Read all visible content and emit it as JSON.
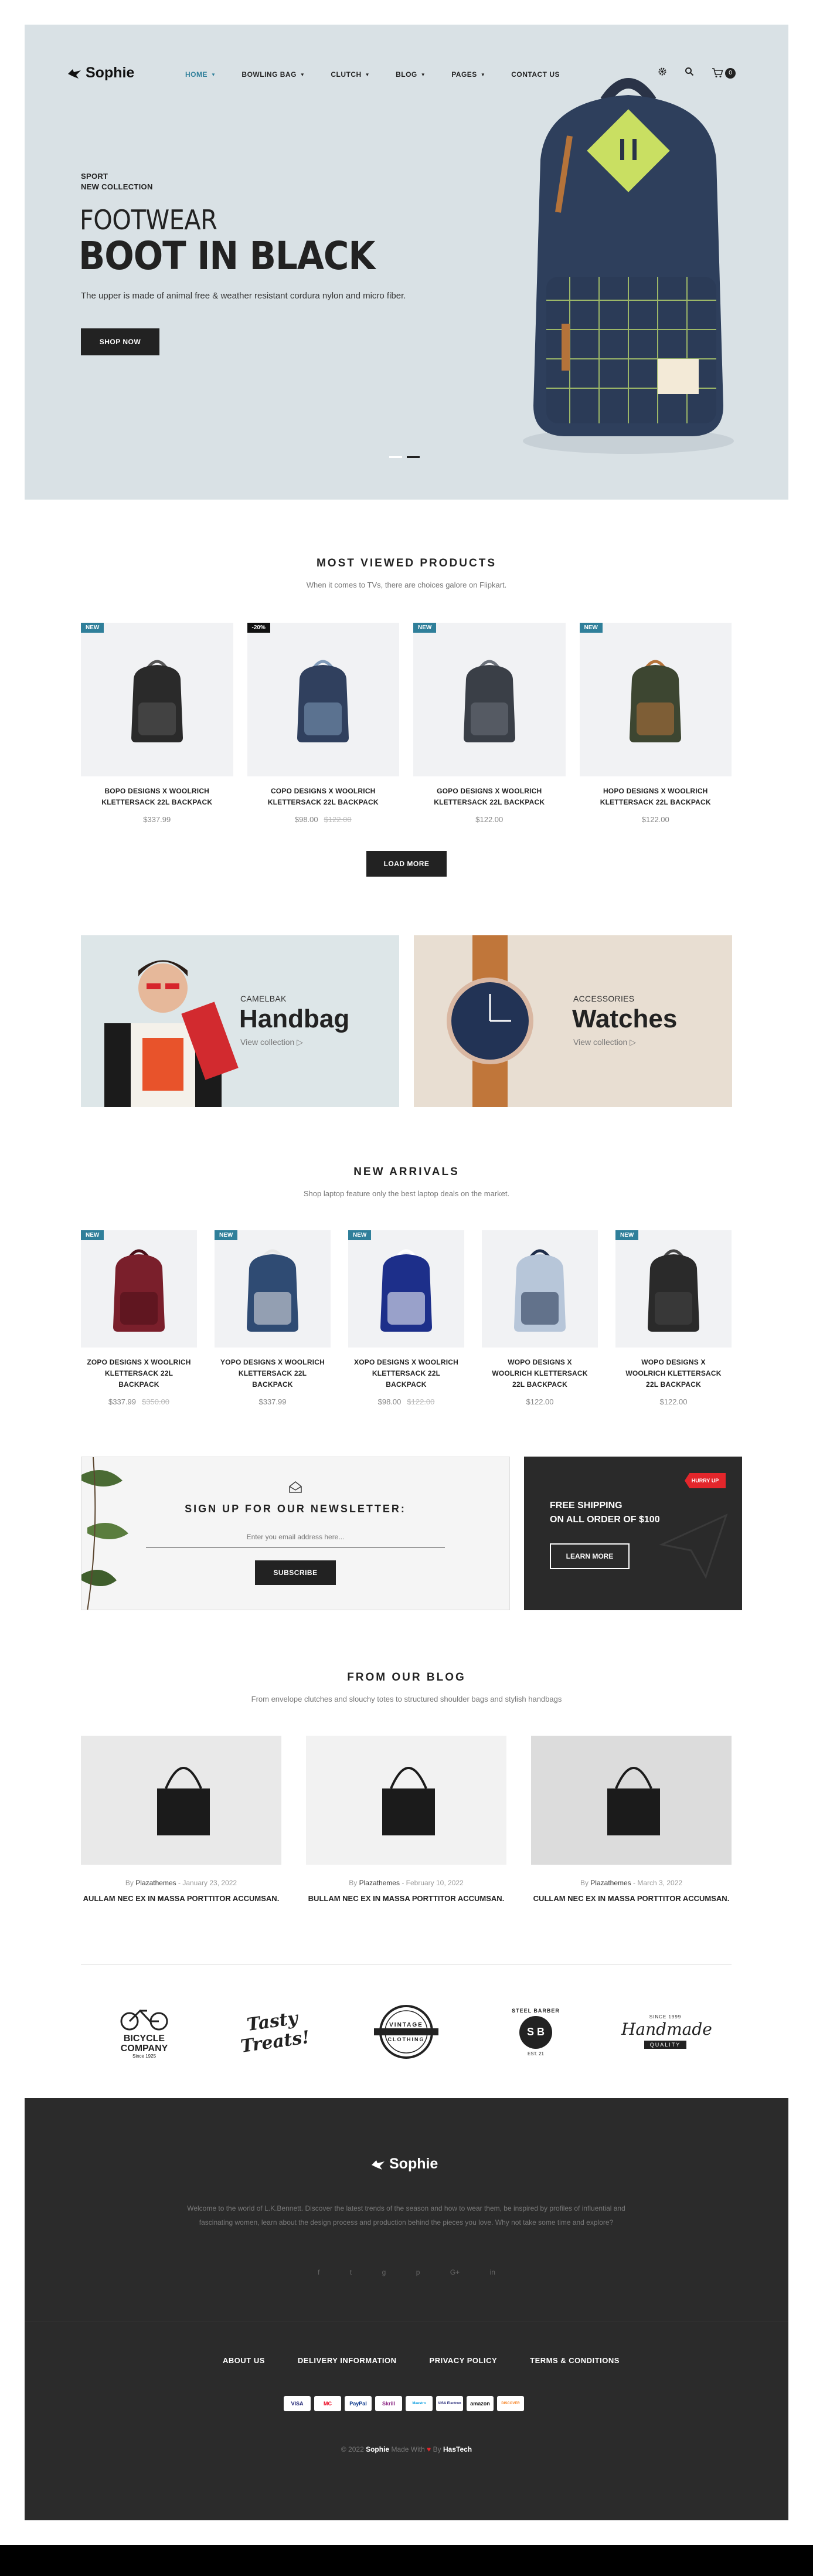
{
  "header": {
    "logo": "Sophie",
    "nav": [
      {
        "label": "HOME",
        "active": true,
        "dropdown": true
      },
      {
        "label": "BOWLING BAG",
        "dropdown": true
      },
      {
        "label": "CLUTCH",
        "dropdown": true
      },
      {
        "label": "BLOG",
        "dropdown": true
      },
      {
        "label": "PAGES",
        "dropdown": true
      },
      {
        "label": "CONTACT US",
        "dropdown": false
      }
    ],
    "cart_count": "0"
  },
  "hero": {
    "tag_line1": "SPORT",
    "tag_line2": "NEW COLLECTION",
    "title_line1": "FOOTWEAR",
    "title_line2": "BOOT IN BLACK",
    "description": "The upper is made of animal free & weather resistant cordura nylon and micro fiber.",
    "cta": "SHOP NOW",
    "slide_count": 2,
    "active_slide": 2
  },
  "most_viewed": {
    "title": "MOST VIEWED PRODUCTS",
    "subtitle": "When it comes to TVs, there are choices galore on Flipkart.",
    "load_more": "LOAD MORE",
    "products": [
      {
        "badge": "NEW",
        "name": "BOPO DESIGNS X WOOLRICH KLETTERSACK 22L BACKPACK",
        "price": "$337.99",
        "old_price": ""
      },
      {
        "badge": "-20%",
        "name": "COPO DESIGNS X WOOLRICH KLETTERSACK 22L BACKPACK",
        "price": "$98.00",
        "old_price": "$122.00"
      },
      {
        "badge": "NEW",
        "name": "GOPO DESIGNS X WOOLRICH KLETTERSACK 22L BACKPACK",
        "price": "$122.00",
        "old_price": ""
      },
      {
        "badge": "NEW",
        "name": "HOPO DESIGNS X WOOLRICH KLETTERSACK 22L BACKPACK",
        "price": "$122.00",
        "old_price": ""
      }
    ]
  },
  "banners": [
    {
      "eyebrow": "CAMELBAK",
      "title": "Handbag",
      "link": "View collection"
    },
    {
      "eyebrow": "ACCESSORIES",
      "title": "Watches",
      "link": "View collection"
    }
  ],
  "new_arrivals": {
    "title": "NEW ARRIVALS",
    "subtitle": "Shop laptop feature only the best laptop deals on the market.",
    "products": [
      {
        "badge": "NEW",
        "name": "ZOPO DESIGNS X WOOLRICH KLETTERSACK 22L BACKPACK",
        "price": "$337.99",
        "old_price": "$350.00"
      },
      {
        "badge": "NEW",
        "name": "YOPO DESIGNS X WOOLRICH KLETTERSACK 22L BACKPACK",
        "price": "$337.99",
        "old_price": ""
      },
      {
        "badge": "NEW",
        "name": "XOPO DESIGNS X WOOLRICH KLETTERSACK 22L BACKPACK",
        "price": "$98.00",
        "old_price": "$122.00"
      },
      {
        "badge": "",
        "name": "WOPO DESIGNS X WOOLRICH KLETTERSACK 22L BACKPACK",
        "price": "$122.00",
        "old_price": ""
      },
      {
        "badge": "NEW",
        "name": "WOPO DESIGNS X WOOLRICH KLETTERSACK 22L BACKPACK",
        "price": "$122.00",
        "old_price": ""
      }
    ]
  },
  "newsletter": {
    "title": "SIGN UP FOR OUR NEWSLETTER:",
    "placeholder": "Enter you email address here...",
    "button": "SUBSCRIBE"
  },
  "promo": {
    "ribbon": "HURRY UP",
    "line1": "FREE SHIPPING",
    "line2": "ON ALL ORDER OF $100",
    "button": "LEARN MORE"
  },
  "blog": {
    "title": "FROM OUR BLOG",
    "subtitle": "From envelope clutches and slouchy totes to structured shoulder bags and stylish handbags",
    "posts": [
      {
        "by": "By",
        "author": "Plazathemes",
        "date": "- January 23, 2022",
        "title": "AULLAM NEC EX IN MASSA PORTTITOR ACCUMSAN."
      },
      {
        "by": "By",
        "author": "Plazathemes",
        "date": "- February 10, 2022",
        "title": "BULLAM NEC EX IN MASSA PORTTITOR ACCUMSAN."
      },
      {
        "by": "By",
        "author": "Plazathemes",
        "date": "- March 3, 2022",
        "title": "CULLAM NEC EX IN MASSA PORTTITOR ACCUMSAN."
      }
    ]
  },
  "brands": [
    {
      "line1": "BICYCLE",
      "line2": "COMPANY",
      "line3": "Since 1925"
    },
    {
      "line1": "Tasty",
      "line2": "Treats!"
    },
    {
      "line1": "VINTAGE",
      "line2": "CLOTHING"
    },
    {
      "line1": "STEEL BARBER",
      "line2": "S B",
      "line3": "EST. 21"
    },
    {
      "line1": "Handmade",
      "line2": "QUALITY",
      "line3": "SINCE 1999"
    }
  ],
  "footer": {
    "logo": "Sophie",
    "about": "Welcome to the world of L.K.Bennett. Discover the latest trends of the season and how to wear them, be inspired by profiles of influential and fascinating women, learn about the design process and production behind the pieces you love. Why not take some time and explore?",
    "social": [
      "f",
      "t",
      "g",
      "p",
      "G+",
      "in"
    ],
    "links": [
      "ABOUT US",
      "DELIVERY INFORMATION",
      "PRIVACY POLICY",
      "TERMS & CONDITIONS"
    ],
    "payments": [
      "VISA",
      "MC",
      "PayPal",
      "Skrill",
      "Maestro",
      "VISA Electron",
      "amazon",
      "DISCOVER"
    ],
    "copyright_pre": "© 2022",
    "copyright_brand": "Sophie",
    "copyright_mid": "Made With",
    "copyright_by": "By",
    "copyright_author": "HasTech"
  },
  "colors": {
    "accent": "#2f7f9a",
    "hero_bg": "#d9e1e5",
    "footer_bg": "#2b2b2b",
    "ribbon": "#e3262b"
  }
}
